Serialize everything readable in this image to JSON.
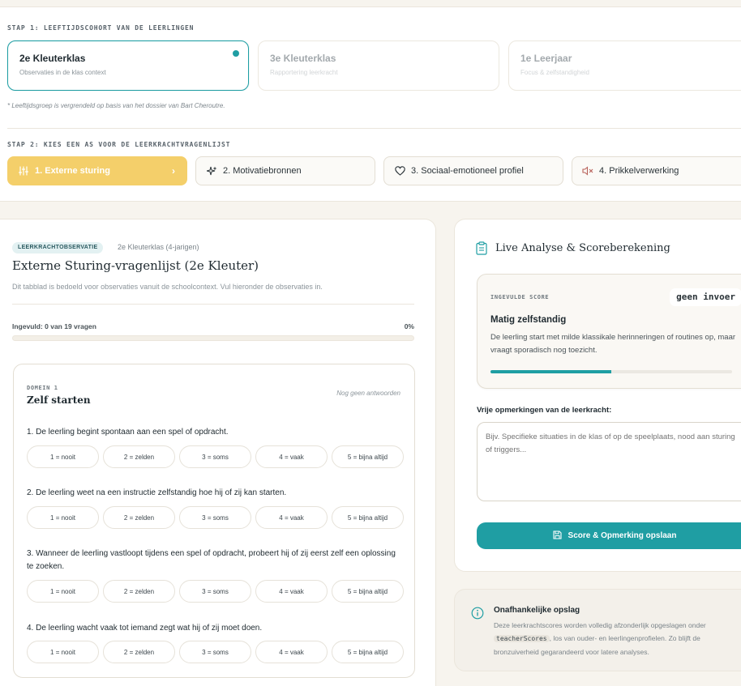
{
  "step1": {
    "label": "STAP 1: LEEFTIJDSCOHORT VAN DE LEERLINGEN",
    "cohorts": [
      {
        "title": "2e Kleuterklas",
        "sub": "Observaties in de klas context"
      },
      {
        "title": "3e Kleuterklas",
        "sub": "Rapportering leerkracht"
      },
      {
        "title": "1e Leerjaar",
        "sub": "Focus & zelfstandigheid"
      }
    ],
    "note": "* Leeftijdsgroep is vergrendeld op basis van het dossier van Bart Cheroutre."
  },
  "step2": {
    "label": "STAP 2: KIES EEN AS VOOR DE LEERKRACHTVRAGENLIJST",
    "axes": [
      {
        "label": "1. Externe sturing",
        "icon": "sliders-icon"
      },
      {
        "label": "2. Motivatiebronnen",
        "icon": "sparkles-icon"
      },
      {
        "label": "3. Sociaal-emotioneel profiel",
        "icon": "heart-icon"
      },
      {
        "label": "4. Prikkelverwerking",
        "icon": "speaker-mute-icon"
      }
    ],
    "chevron": "›"
  },
  "questionnaire": {
    "badge": "LEERKRACHTOBSERVATIE",
    "badge_side": "2e Kleuterklas (4-jarigen)",
    "title": "Externe Sturing-vragenlijst (2e Kleuter)",
    "description": "Dit tabblad is bedoeld voor observaties vanuit de schoolcontext. Vul hieronder de observaties in.",
    "progress_label": "Ingevuld: 0 van 19 vragen",
    "progress_pct": "0%",
    "progress_value": 0,
    "domain": {
      "kicker": "DOMEIN 1",
      "title": "Zelf starten",
      "status": "Nog geen antwoorden",
      "questions": [
        {
          "text": "1. De leerling begint spontaan aan een spel of opdracht."
        },
        {
          "text": "2. De leerling weet na een instructie zelfstandig hoe hij of zij kan starten."
        },
        {
          "text": "3. Wanneer de leerling vastloopt tijdens een spel of opdracht, probeert hij of zij eerst zelf een oplossing te zoeken."
        },
        {
          "text": "4. De leerling wacht vaak tot iemand zegt wat hij of zij moet doen."
        }
      ],
      "options": [
        "1 = nooit",
        "2 = zelden",
        "3 = soms",
        "4 = vaak",
        "5 = bijna altijd"
      ]
    }
  },
  "analysis": {
    "title": "Live Analyse & Scoreberekening",
    "kicker": "INGEVULDE SCORE",
    "chip": "geen invoer",
    "score_title": "Matig zelfstandig",
    "score_desc": "De leerling start met milde klassikale herinneringen of routines op, maar vraagt sporadisch nog toezicht.",
    "score_fraction": 0.5,
    "remarks_label": "Vrije opmerkingen van de leerkracht:",
    "remarks_placeholder": "Bijv. Specifieke situaties in de klas of op de speelplaats, nood aan sturing of triggers...",
    "save_label": "Score & Opmerking opslaan"
  },
  "info": {
    "title": "Onafhankelijke opslag",
    "text_before": "Deze leerkrachtscores worden volledig afzonderlijk opgeslagen onder",
    "code": "teacherScores",
    "text_after": ", los van ouder- en leerlingenprofielen. Zo blijft de bronzuiverheid gegarandeerd voor latere analyses."
  },
  "colors": {
    "accent": "#1f9ea3",
    "active_axis": "#f4cf6a"
  }
}
